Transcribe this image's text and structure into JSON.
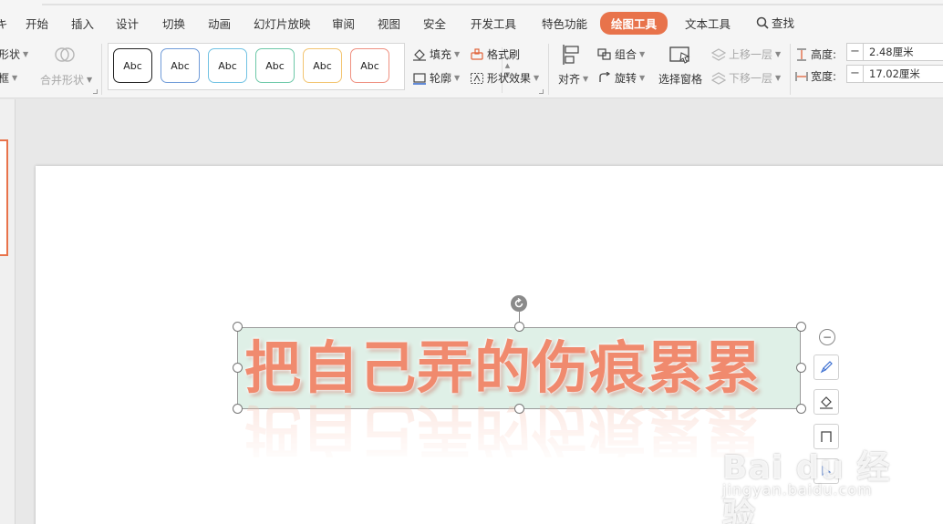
{
  "menubar": {
    "left_cut": "キ",
    "items": [
      "开始",
      "插入",
      "设计",
      "切换",
      "动画",
      "幻灯片放映",
      "审阅",
      "视图",
      "安全",
      "开发工具",
      "特色功能",
      "绘图工具",
      "文本工具"
    ],
    "active": "绘图工具",
    "search_label": "查找"
  },
  "ribbon": {
    "shape_label": "形状",
    "frame_label": "框",
    "merge_shapes": "合并形状",
    "style_samples": [
      "Abc",
      "Abc",
      "Abc",
      "Abc",
      "Abc",
      "Abc"
    ],
    "style_colors": [
      "#222222",
      "#6f9bd8",
      "#71c2e3",
      "#6dc8a8",
      "#f3c470",
      "#ef9080"
    ],
    "fill": "填充",
    "outline": "轮廓",
    "format_painter": "格式刷",
    "shape_effects": "形状效果",
    "align": "对齐",
    "group": "组合",
    "rotate": "旋转",
    "selection_pane": "选择窗格",
    "bring_forward": "上移一层",
    "send_backward": "下移一层",
    "height_label": "高度:",
    "height_value": "2.48厘米",
    "width_label": "宽度:",
    "width_value": "17.02厘米"
  },
  "slide": {
    "wordart_text": "把自己弄的伤痕累累"
  },
  "watermark": {
    "logo": "Bai du 经验",
    "url": "jingyan.baidu.com"
  },
  "colors": {
    "accent": "#e8734b",
    "wordart": "#f08a6e",
    "textbox_fill": "#dff0e7"
  }
}
